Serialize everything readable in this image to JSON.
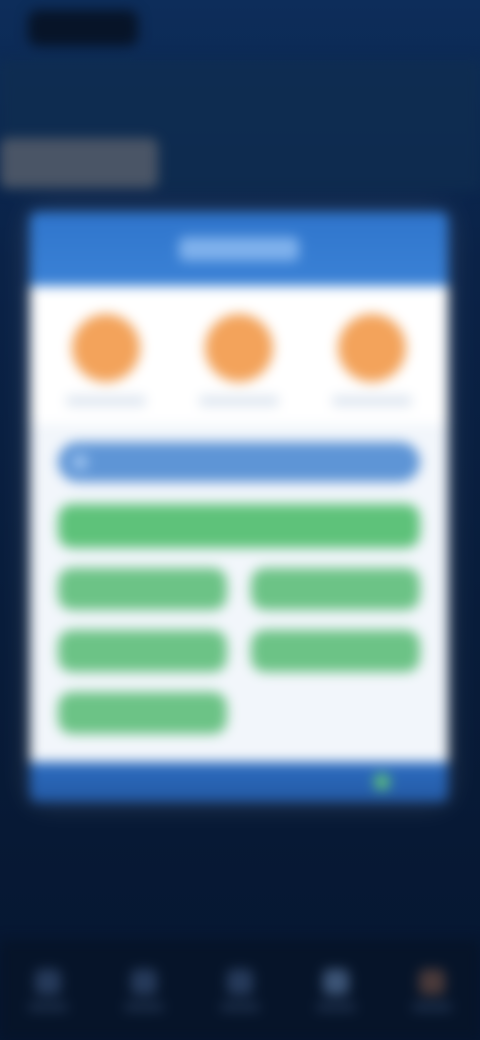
{
  "topbar": {
    "back_label": "",
    "subtitle": ""
  },
  "card": {
    "title": "",
    "stats": [
      {
        "label": ""
      },
      {
        "label": ""
      },
      {
        "label": ""
      }
    ],
    "search_bar": {
      "placeholder": ""
    },
    "primary_button": "",
    "buttons": [
      "",
      "",
      "",
      "",
      ""
    ],
    "footer_status_color": "#5ec27a"
  },
  "colors": {
    "header_blue": "#2f75cc",
    "stat_orange": "#f3a35b",
    "button_green": "#6cc386",
    "background_navy": "#0a2247"
  },
  "bottom_nav": {
    "items": [
      {
        "icon": "home-icon",
        "label": ""
      },
      {
        "icon": "list-icon",
        "label": ""
      },
      {
        "icon": "grid-icon",
        "label": ""
      },
      {
        "icon": "user-icon",
        "label": ""
      },
      {
        "icon": "more-icon",
        "label": ""
      }
    ]
  }
}
